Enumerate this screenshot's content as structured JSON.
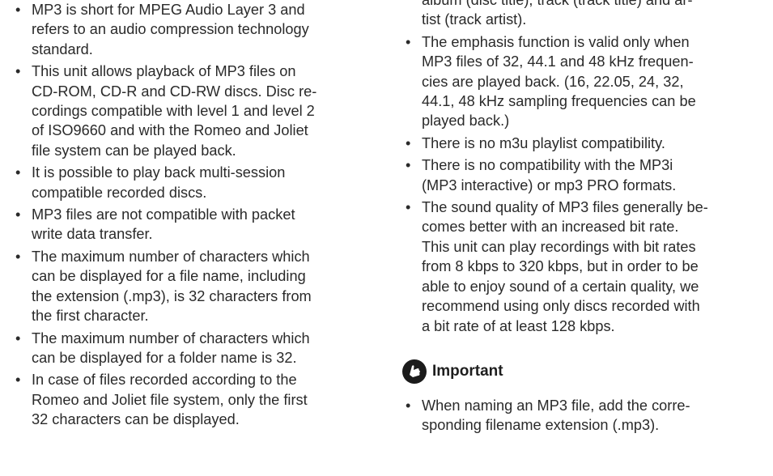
{
  "left_bullets": [
    {
      "lines": [
        "MP3 is short for MPEG Audio Layer 3 and",
        "refers to an audio compression technology",
        "standard."
      ]
    },
    {
      "lines": [
        "This unit allows playback of MP3 files on",
        "CD-ROM, CD-R and CD-RW discs. Disc re-",
        "cordings compatible with level 1 and level 2",
        "of ISO9660 and with the Romeo and Joliet",
        "file system can be played back."
      ]
    },
    {
      "lines": [
        "It is possible to play back multi-session",
        "compatible recorded discs."
      ]
    },
    {
      "lines": [
        "MP3 files are not compatible with packet",
        "write data transfer."
      ]
    },
    {
      "lines": [
        "The maximum number of characters which",
        "can be displayed for a file name, including",
        "the extension (.mp3), is 32 characters from",
        "the first character."
      ]
    },
    {
      "lines": [
        "The maximum number of characters which",
        "can be displayed for a folder name is 32."
      ]
    },
    {
      "lines": [
        "In case of files recorded according to the",
        "Romeo and Joliet file system, only the first",
        "32 characters can be displayed."
      ]
    }
  ],
  "right_continuation": [
    "album (disc title), track (track title) and ar-",
    "tist (track artist)."
  ],
  "right_bullets": [
    {
      "lines": [
        "The emphasis function is valid only when",
        "MP3 files of 32, 44.1 and 48 kHz frequen-",
        "cies are played back. (16, 22.05, 24, 32,",
        "44.1, 48 kHz sampling frequencies can be",
        "played back.)"
      ]
    },
    {
      "lines": [
        "There is no m3u playlist compatibility."
      ]
    },
    {
      "lines": [
        "There is no compatibility with the MP3i",
        "(MP3 interactive) or mp3 PRO formats."
      ]
    },
    {
      "lines": [
        "The sound quality of MP3 files generally be-",
        "comes better with an increased bit rate.",
        "This unit can play recordings with bit rates",
        "from 8 kbps to 320 kbps, but in order to be",
        "able to enjoy sound of a certain quality, we",
        "recommend using only discs recorded with",
        "a bit rate of at least 128 kbps."
      ]
    }
  ],
  "important": {
    "icon": "important-hand-icon",
    "title": "Important",
    "bullets": [
      {
        "lines": [
          "When naming an MP3 file, add the corre-",
          "sponding filename extension (.mp3)."
        ]
      }
    ]
  }
}
